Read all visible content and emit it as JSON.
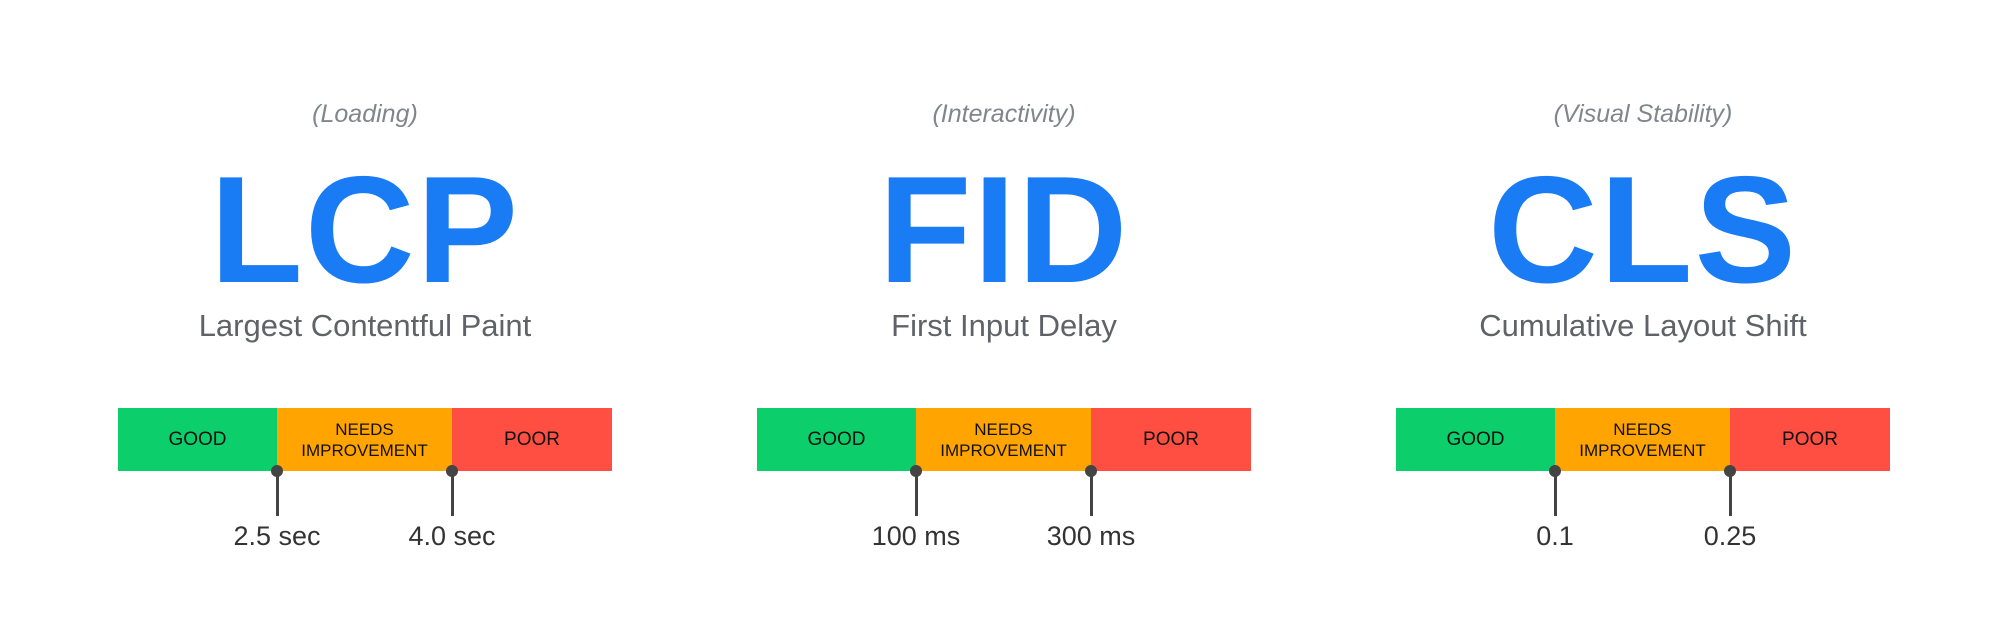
{
  "colors": {
    "good": "#0cce6b",
    "needs_improvement": "#ffa400",
    "poor": "#ff4e42",
    "accent": "#1a7cf5"
  },
  "segments": {
    "good": "GOOD",
    "needs_improvement": "NEEDS IMPROVEMENT",
    "poor": "POOR"
  },
  "metrics": [
    {
      "category": "(Loading)",
      "abbr": "LCP",
      "name": "Largest Contentful Paint",
      "thresholds": [
        "2.5 sec",
        "4.0 sec"
      ]
    },
    {
      "category": "(Interactivity)",
      "abbr": "FID",
      "name": "First Input Delay",
      "thresholds": [
        "100 ms",
        "300 ms"
      ]
    },
    {
      "category": "(Visual Stability)",
      "abbr": "CLS",
      "name": "Cumulative Layout Shift",
      "thresholds": [
        "0.1",
        "0.25"
      ]
    }
  ]
}
